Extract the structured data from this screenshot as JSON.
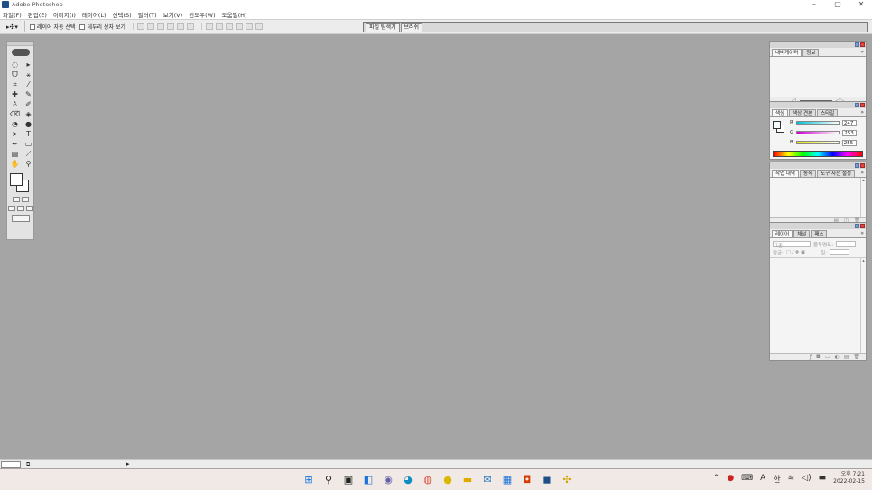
{
  "window": {
    "title": "Adobe Photoshop",
    "controls": [
      "–",
      "▢",
      "✕"
    ]
  },
  "menu": [
    "파일(F)",
    "편집(E)",
    "이미지(I)",
    "레이어(L)",
    "선택(S)",
    "필터(T)",
    "보기(V)",
    "윈도우(W)",
    "도움말(H)"
  ],
  "options": {
    "auto_select_label": "레이어 자동 선택",
    "bounding_box_label": "테두리 상자 보기",
    "palette_well_tabs": [
      "파일 탐색기",
      "브러쉬"
    ]
  },
  "palettes": {
    "navigator": {
      "tabs": [
        "내비게이터",
        "정보"
      ]
    },
    "color": {
      "tabs": [
        "색상",
        "색상 견본",
        "스타일"
      ],
      "r_label": "R",
      "g_label": "G",
      "b_label": "B",
      "r": "247",
      "g": "253",
      "b": "255",
      "r_color": "#00c2d8",
      "g_color": "#d000d0",
      "b_color": "#e6e600"
    },
    "history": {
      "tabs": [
        "작업 내역",
        "동작",
        "도구 사전 설정"
      ]
    },
    "layers": {
      "tabs": [
        "레이어",
        "채널",
        "패스"
      ],
      "blend_mode": "표준",
      "opacity_label": "불투명도:",
      "lock_label": "잠금:",
      "fill_label": "칠:"
    }
  },
  "taskbar": {
    "time": "오후 7:21",
    "date": "2022-02-15",
    "ime": "A",
    "lang": "한"
  }
}
